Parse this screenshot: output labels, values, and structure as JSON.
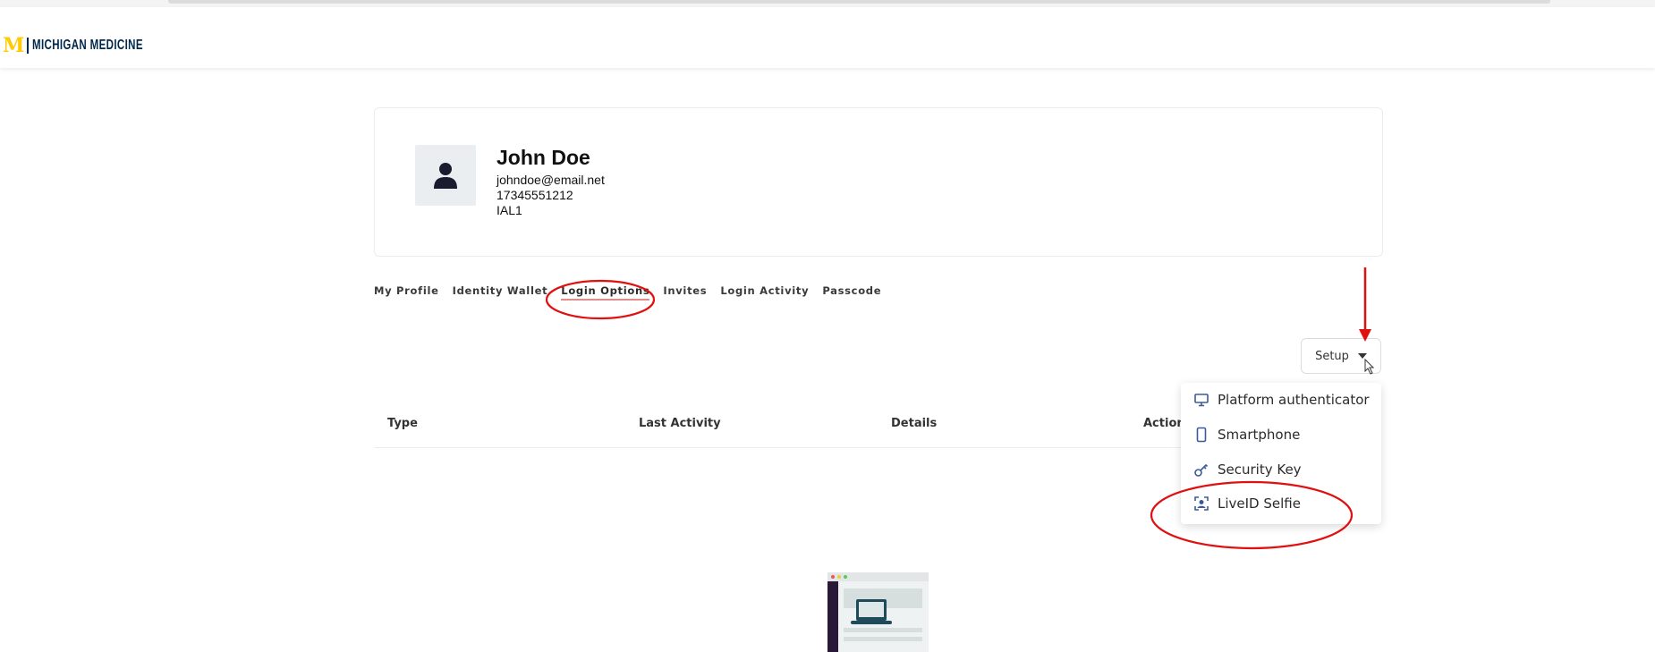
{
  "brand": {
    "logo_mark": "M",
    "logo_text": "MICHIGAN MEDICINE"
  },
  "profile": {
    "name": "John Doe",
    "email": "johndoe@email.net",
    "phone": "17345551212",
    "level": "IAL1"
  },
  "tabs": [
    {
      "label": "My Profile"
    },
    {
      "label": "Identity Wallet"
    },
    {
      "label": "Login Options",
      "active": true
    },
    {
      "label": "Invites"
    },
    {
      "label": "Login Activity"
    },
    {
      "label": "Passcode"
    }
  ],
  "setup": {
    "label": "Setup"
  },
  "table": {
    "columns": [
      "Type",
      "Last Activity",
      "Details",
      "Action"
    ]
  },
  "setup_menu": {
    "items": [
      {
        "label": "Platform authenticator",
        "icon": "monitor-icon"
      },
      {
        "label": "Smartphone",
        "icon": "smartphone-icon"
      },
      {
        "label": "Security Key",
        "icon": "key-icon"
      },
      {
        "label": "LiveID Selfie",
        "icon": "face-scan-icon"
      }
    ]
  },
  "colors": {
    "brand_maize": "#FFCB05",
    "brand_blue": "#00274C",
    "icon_accent": "#3d5a98",
    "annotation_red": "#e01010"
  }
}
